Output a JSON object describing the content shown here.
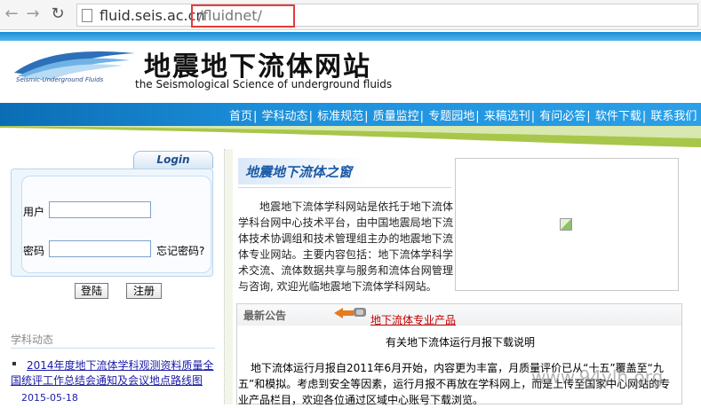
{
  "browser": {
    "url_host": "fluid.seis.ac.cn",
    "url_path": "/fluidnet/"
  },
  "header": {
    "logo_cn": "地震地下流体网站",
    "logo_en": "the Seismological Science of underground fluids",
    "logo_sub": "Seismic-Underground Fluids"
  },
  "nav": {
    "items": [
      "首页",
      "学科动态",
      "标准规范",
      "质量监控",
      "专题园地",
      "来稿选刊",
      "有问必答",
      "软件下载",
      "联系我们"
    ]
  },
  "login": {
    "tab_label": "Login",
    "user_label": "用户",
    "password_label": "密码",
    "forgot_label": "忘记密码?",
    "login_button": "登陆",
    "register_button": "注册"
  },
  "news": {
    "section_title": "学科动态",
    "item_title": "2014年度地下流体学科观测资料质量全国统评工作总结会通知及会议地点路线图",
    "item_date": "2015-05-18"
  },
  "about": {
    "title": "地震地下流体之窗",
    "text": "地震地下流体学科网站是依托于地下流体学科台网中心技术平台，由中国地震局地下流体技术协调组和技术管理组主办的地震地下流体专业网站。主要内容包括：地下流体学科学术交流、流体数据共享与服务和流体台网管理与咨询, 欢迎光临地震地下流体学科网站。"
  },
  "notice": {
    "section_title": "最新公告",
    "product_link": "地下流体专业产品",
    "heading": "有关地下流体运行月报下载说明",
    "body": "地下流体运行月报自2011年6月开始，内容更为丰富，月质量评价已从“十五”覆盖至“九五”和模拟。考虑到安全等因素，运行月报不再放在学科网上，而是上传至国家中心网站的专业产品栏目，欢迎各位通过区域中心账号下载浏览。"
  },
  "watermark": "www.94ylh.org"
}
